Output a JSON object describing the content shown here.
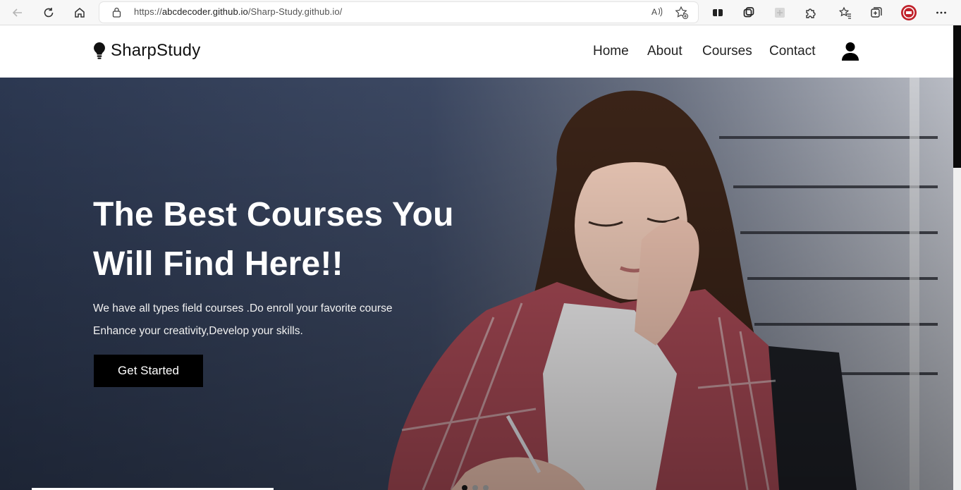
{
  "browser": {
    "url_scheme": "https://",
    "url_host": "abcdecoder.github.io",
    "url_path": "/Sharp-Study.github.io/"
  },
  "header": {
    "brand": "SharpStudy",
    "logo_icon": "lightbulb-icon",
    "nav": [
      {
        "label": "Home"
      },
      {
        "label": "About"
      },
      {
        "label": "Courses"
      },
      {
        "label": "Contact"
      }
    ],
    "user_icon": "user-icon"
  },
  "hero": {
    "title_lines": [
      "The Best Courses You",
      "Will Find Here!!"
    ],
    "text_lines": [
      "We have all types field courses .Do enroll your favorite course",
      "Enhance your creativity,Develop your skills."
    ],
    "cta_label": "Get Started",
    "slider_dots": 3,
    "active_dot": 0
  },
  "colors": {
    "hero_overlay": "#35425a",
    "button": "#000000",
    "text_light": "#ffffff"
  }
}
